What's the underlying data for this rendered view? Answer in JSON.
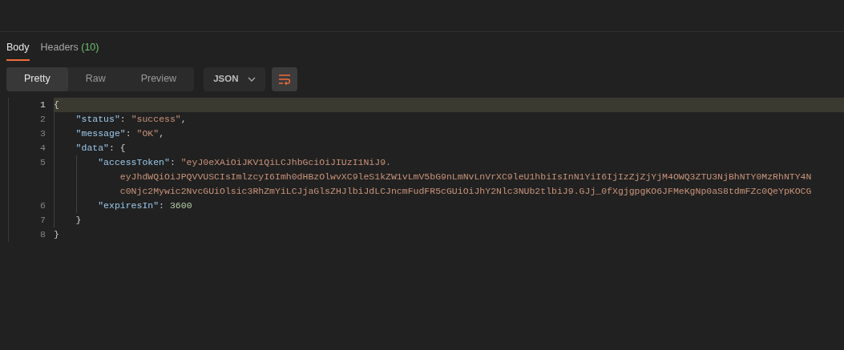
{
  "tabs": [
    {
      "label": "Body",
      "selected": true
    },
    {
      "label": "Headers",
      "count": "(10)",
      "selected": false
    }
  ],
  "view_modes": [
    {
      "label": "Pretty",
      "selected": true
    },
    {
      "label": "Raw",
      "selected": false
    },
    {
      "label": "Preview",
      "selected": false
    }
  ],
  "format": "JSON",
  "wrap": {
    "on": true
  },
  "code_lines": [
    {
      "number": "1",
      "current": true,
      "tokens": [
        {
          "kind": "punct",
          "text": "{"
        }
      ],
      "children": [
        {
          "number": "2",
          "current": false,
          "tokens": [
            {
              "kind": "key",
              "text": "\"status\""
            },
            {
              "kind": "punct",
              "text": ": "
            },
            {
              "kind": "string",
              "text": "\"success\""
            },
            {
              "kind": "punct",
              "text": ","
            }
          ]
        },
        {
          "number": "3",
          "current": false,
          "tokens": [
            {
              "kind": "key",
              "text": "\"message\""
            },
            {
              "kind": "punct",
              "text": ": "
            },
            {
              "kind": "string",
              "text": "\"OK\""
            },
            {
              "kind": "punct",
              "text": ","
            }
          ]
        },
        {
          "number": "4",
          "current": false,
          "tokens": [
            {
              "kind": "key",
              "text": "\"data\""
            },
            {
              "kind": "punct",
              "text": ": {"
            }
          ],
          "children": [
            {
              "number": "5",
              "current": false,
              "tokens": [
                {
                  "kind": "key",
                  "text": "\"accessToken\""
                },
                {
                  "kind": "punct",
                  "text": ": "
                },
                {
                  "kind": "string",
                  "text": "\"eyJ0eXAiOiJKV1QiLCJhbGciOiJIUzI1NiJ9."
                }
              ],
              "continuation": [
                "eyJhdWQiOiJPQVVUSCIsImlzcyI6Imh0dHBzOlwvXC9leS1kZW1vLmV5bG9nLmNvLnVrXC9leU1hbiIsInN1YiI6IjIzZjZjYjM4OWQ3ZTU3NjBhNTY0MzRhNTY4N",
                "c0Njc2Mywic2NvcGUiOlsic3RhZmYiLCJjaGlsZHJlbiJdLCJncmFudFR5cGUiOiJhY2Nlc3NUb2tlbiJ9.GJj_0fXgjgpgKO6JFMeKgNp0aS8tdmFZc0QeYpKOCG"
              ]
            },
            {
              "number": "6",
              "current": false,
              "tokens": [
                {
                  "kind": "key",
                  "text": "\"expiresIn\""
                },
                {
                  "kind": "punct",
                  "text": ": "
                },
                {
                  "kind": "number",
                  "text": "3600"
                }
              ]
            }
          ]
        },
        {
          "number": "7",
          "current": false,
          "tokens": [
            {
              "kind": "punct",
              "text": "}"
            }
          ]
        }
      ]
    },
    {
      "number": "8",
      "current": false,
      "tokens": [
        {
          "kind": "punct",
          "text": "}"
        }
      ]
    }
  ]
}
